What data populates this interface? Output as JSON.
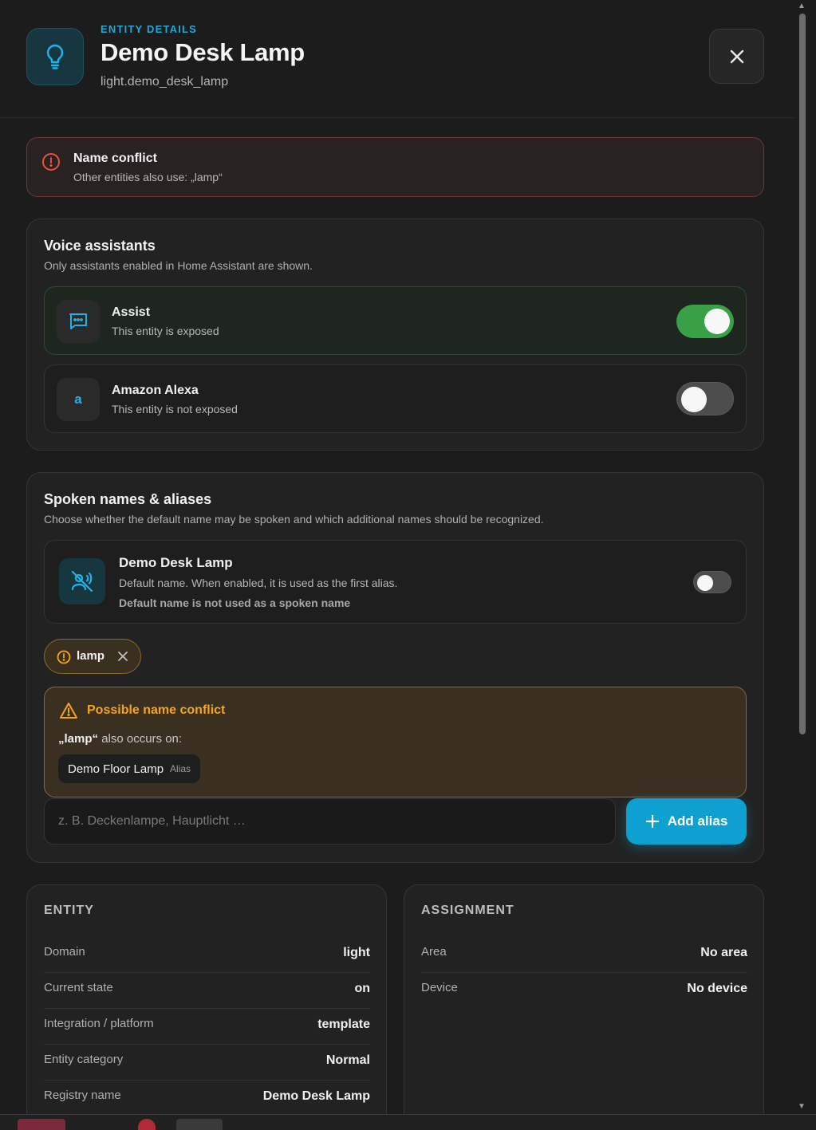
{
  "header": {
    "eyebrow": "ENTITY DETAILS",
    "title": "Demo Desk Lamp",
    "entity_id": "light.demo_desk_lamp",
    "icon": "lightbulb-icon",
    "close_icon": "close-icon"
  },
  "error_banner": {
    "title": "Name conflict",
    "message": "Other entities also use: „lamp“",
    "icon": "alert-circle-icon",
    "color": "#e5533d"
  },
  "voice_assistants": {
    "title": "Voice assistants",
    "subtitle": "Only assistants enabled in Home Assistant are shown.",
    "items": [
      {
        "name": "Assist",
        "status": "This entity is exposed",
        "exposed": true,
        "icon": "chat-bubble-icon"
      },
      {
        "name": "Amazon Alexa",
        "status": "This entity is not exposed",
        "exposed": false,
        "icon": "alexa-icon",
        "icon_glyph": "a"
      }
    ]
  },
  "spoken_names": {
    "title": "Spoken names & aliases",
    "subtitle": "Choose whether the default name may be spoken and which additional names should be recognized.",
    "default_name": {
      "name": "Demo Desk Lamp",
      "description": "Default name. When enabled, it is used as the first alias.",
      "note": "Default name is not used as a spoken name",
      "enabled": false,
      "icon": "voice-off-icon"
    },
    "aliases": [
      {
        "label": "lamp",
        "warning": true
      }
    ],
    "conflict": {
      "title": "Possible name conflict",
      "alias_quoted": "„lamp“",
      "occurs_text": "also occurs on:",
      "entities": [
        {
          "name": "Demo Floor Lamp",
          "kind": "Alias"
        }
      ],
      "color": "#f2a51e"
    },
    "input_placeholder": "z. B. Deckenlampe, Hauptlicht …",
    "input_value": "",
    "add_button": "Add alias",
    "accent": "#0ea0d0"
  },
  "entity_info": {
    "title": "ENTITY",
    "rows": [
      {
        "key": "Domain",
        "value": "light"
      },
      {
        "key": "Current state",
        "value": "on"
      },
      {
        "key": "Integration / platform",
        "value": "template"
      },
      {
        "key": "Entity category",
        "value": "Normal"
      },
      {
        "key": "Registry name",
        "value": "Demo Desk Lamp"
      }
    ]
  },
  "assignment_info": {
    "title": "ASSIGNMENT",
    "rows": [
      {
        "key": "Area",
        "value": "No area"
      },
      {
        "key": "Device",
        "value": "No device"
      }
    ]
  }
}
